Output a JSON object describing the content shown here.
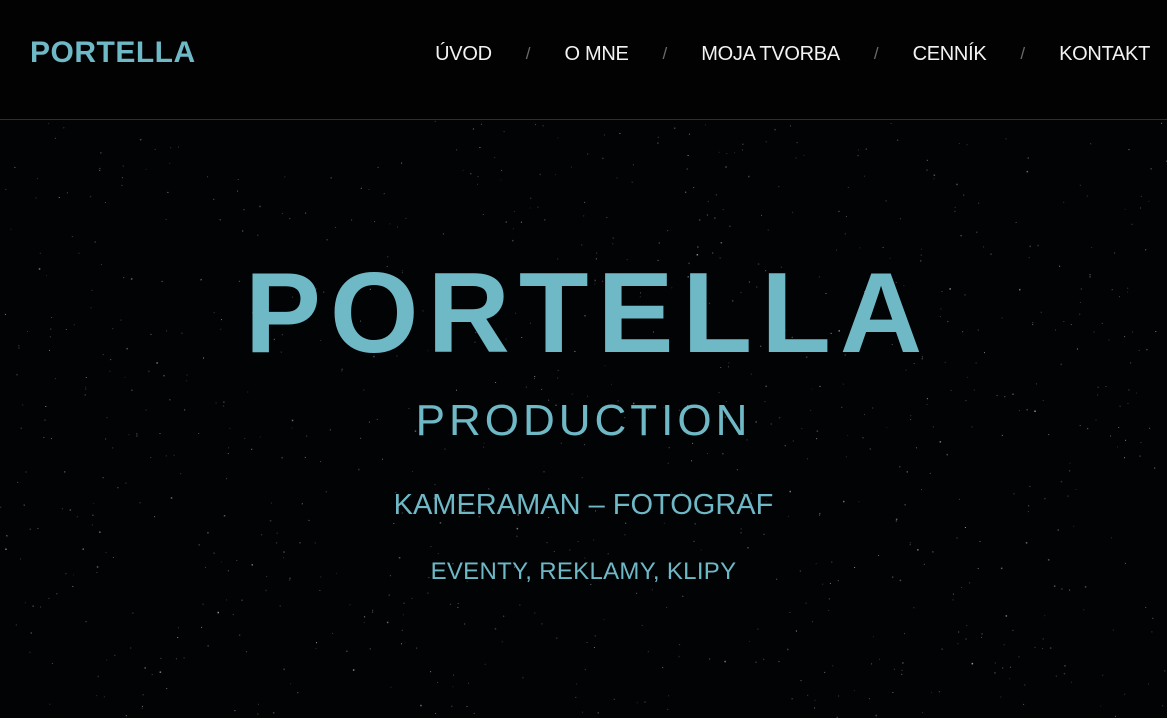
{
  "header": {
    "logo": "PORTELLA",
    "nav": [
      {
        "label": "ÚVOD"
      },
      {
        "label": "O MNE"
      },
      {
        "label": "MOJA TVORBA"
      },
      {
        "label": "CENNÍK"
      },
      {
        "label": "KONTAKT"
      }
    ],
    "separator": "/"
  },
  "hero": {
    "title": "PORTELLA",
    "subtitle": "PRODUCTION",
    "role": "KAMERAMAN – FOTOGRAF",
    "services": "EVENTY, REKLAMY, KLIPY"
  },
  "colors": {
    "accent": "#6fb8c6",
    "background": "#000000",
    "nav_text": "#f2f2f2"
  }
}
